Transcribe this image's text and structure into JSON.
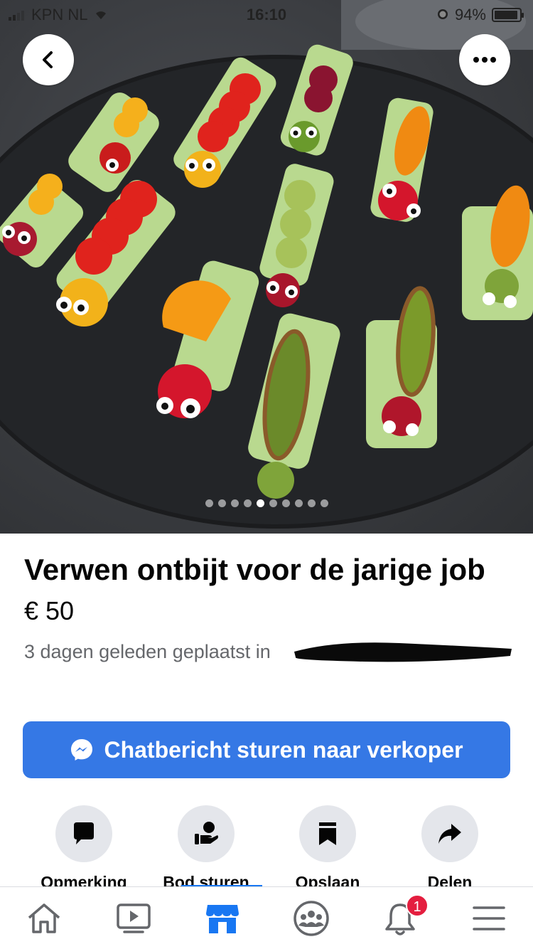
{
  "status_bar": {
    "carrier": "KPN NL",
    "time": "16:10",
    "battery_percent": "94%",
    "battery_level": 0.94
  },
  "gallery": {
    "photo_count": 10,
    "active_index": 4,
    "icons": {
      "back": "chevron-left-icon",
      "more": "more-horizontal-icon"
    }
  },
  "listing": {
    "title": "Verwen ontbijt voor de jarige job",
    "price": "€ 50",
    "posted": "3 dagen geleden geplaatst in"
  },
  "cta": {
    "label": "Chatbericht sturen naar verkoper",
    "icon": "messenger-icon",
    "color": "#3578e5"
  },
  "actions": [
    {
      "label": "Opmerking",
      "icon": "comment-icon"
    },
    {
      "label": "Bod sturen",
      "icon": "offer-icon"
    },
    {
      "label": "Opslaan",
      "icon": "bookmark-icon"
    },
    {
      "label": "Delen",
      "icon": "share-icon"
    }
  ],
  "bottom_nav": {
    "items": [
      "home-icon",
      "watch-icon",
      "marketplace-icon",
      "groups-icon",
      "notifications-icon",
      "menu-icon"
    ],
    "active": "marketplace-icon",
    "notification_count": "1",
    "accent": "#1877f2"
  }
}
